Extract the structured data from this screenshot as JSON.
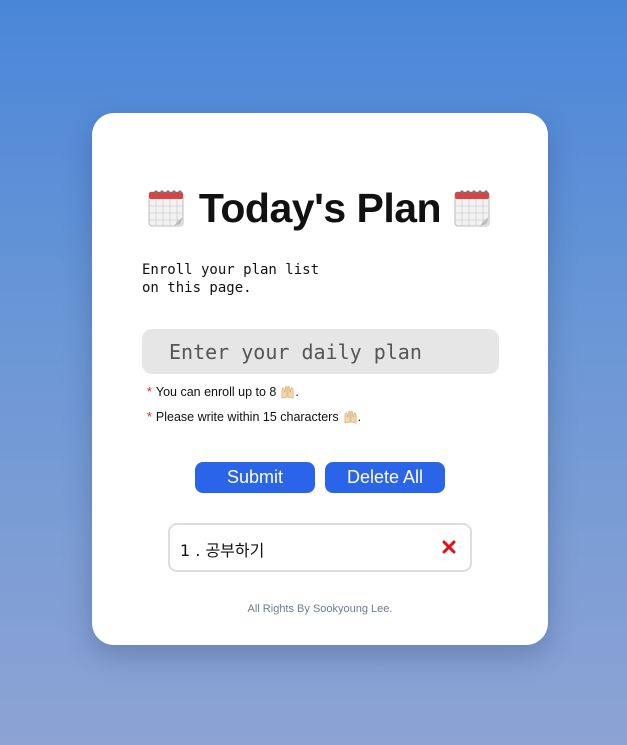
{
  "header": {
    "title": "Today's Plan",
    "left_icon": "calendar-icon",
    "right_icon": "calendar-icon"
  },
  "description": {
    "line1": "Enroll your plan list",
    "line2": "on this page."
  },
  "plan_input": {
    "placeholder": "Enter your daily plan",
    "value": ""
  },
  "notes": [
    {
      "marker": "*",
      "text": "You can enroll up to 8",
      "icon": "raised-hands-icon",
      "end": "."
    },
    {
      "marker": "*",
      "text": "Please write within 15 characters",
      "icon": "raised-hands-icon",
      "end": "."
    }
  ],
  "buttons": {
    "submit": "Submit",
    "delete_all": "Delete All"
  },
  "plans": [
    {
      "text": "1 . 공부하기",
      "remove_icon": "close-icon"
    }
  ],
  "footer": "All Rights By Sookyoung Lee.",
  "colors": {
    "background_top": "#4a86d8",
    "background_bottom": "#8da3d4",
    "card": "#ffffff",
    "button": "#2a64e8",
    "input_bg": "#e6e6e6",
    "asterisk": "#e02020",
    "remove": "#e01010",
    "footer_text": "#6f7d8c"
  }
}
